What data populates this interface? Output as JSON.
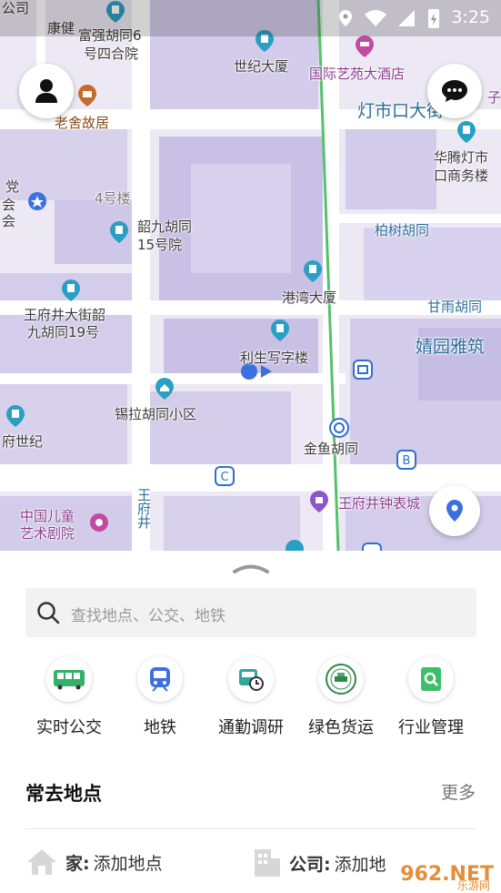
{
  "status_bar": {
    "time": "3:25"
  },
  "map": {
    "labels": {
      "gongsi": "公司",
      "fuqiang": "富强胡同6",
      "fuqiang2": "号四合院",
      "kangjian": "康健",
      "shiji": "世纪大厦",
      "guojiyiyuan": "国际艺苑大酒店",
      "laoshe": "老舍故居",
      "dengshikou": "灯市口大街",
      "huateng1": "华腾灯市",
      "huateng2": "口商务楼",
      "dangwei1": "党",
      "dangwei2": "会",
      "dangwei3": "会",
      "building4": "4号楼",
      "shaojiu1": "韶九胡同",
      "shaojiu2": "15号院",
      "baishu": "柏树胡同",
      "gangwan": "港湾大厦",
      "ganyu": "甘雨胡同",
      "wfj_shaojiu1": "王府井大街韶",
      "wfj_shaojiu2": "九胡同19号",
      "jingyuan": "婧园雅筑",
      "lisheng": "利生写字楼",
      "xila": "锡拉胡同小区",
      "fushiji": "府世纪",
      "jinyu": "金鱼胡同",
      "zhongguo1": "中国儿童",
      "zhongguo2": "艺术剧院",
      "wfj_vert": "王府井",
      "zhongbiao": "王府井钟表城",
      "zizi": "子"
    }
  },
  "search": {
    "placeholder": "查找地点、公交、地铁"
  },
  "quick_actions": [
    {
      "label": "实时公交",
      "icon": "bus-icon"
    },
    {
      "label": "地铁",
      "icon": "subway-icon"
    },
    {
      "label": "通勤调研",
      "icon": "commute-survey-icon"
    },
    {
      "label": "绿色货运",
      "icon": "green-freight-icon"
    },
    {
      "label": "行业管理",
      "icon": "industry-management-icon"
    }
  ],
  "frequent": {
    "title": "常去地点",
    "more": "更多",
    "home_label": "家:",
    "home_value": "添加地点",
    "company_label": "公司:",
    "company_value": "添加地"
  },
  "watermark": {
    "text": "962.NET",
    "sub": "乐游网"
  },
  "colors": {
    "accent": "#3d6fe0",
    "map_bg": "#ede9f5",
    "building": "#c9c0e6",
    "poi": "#2a9fc4"
  }
}
